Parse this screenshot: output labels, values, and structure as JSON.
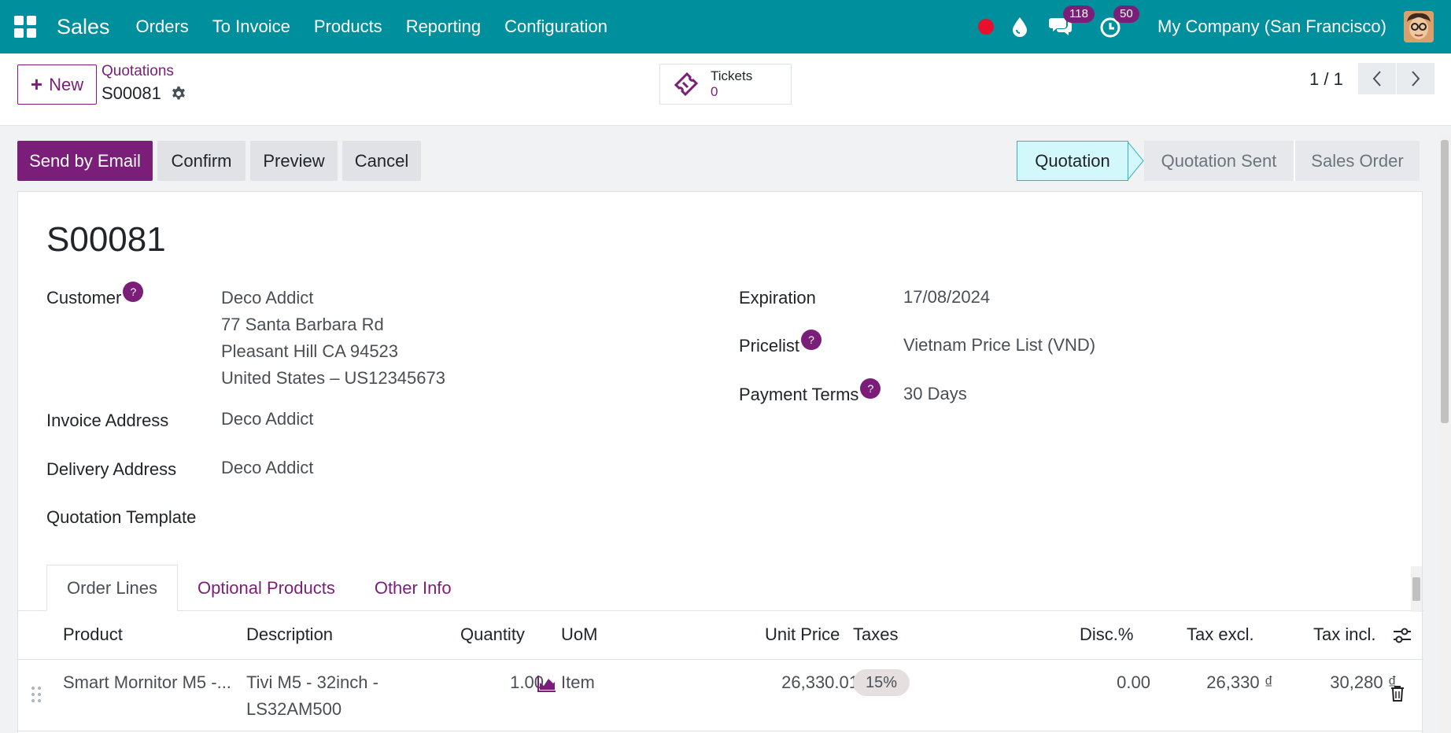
{
  "navbar": {
    "app_name": "Sales",
    "menu": [
      "Orders",
      "To Invoice",
      "Products",
      "Reporting",
      "Configuration"
    ],
    "messages_count": "118",
    "activities_count": "50",
    "company": "My Company (San Francisco)",
    "accent": "#008f9c"
  },
  "control": {
    "new_label": "New",
    "breadcrumb_parent": "Quotations",
    "breadcrumb_current": "S00081",
    "tickets_label": "Tickets",
    "tickets_count": "0",
    "pager": "1 / 1"
  },
  "actions": {
    "send_email": "Send by Email",
    "confirm": "Confirm",
    "preview": "Preview",
    "cancel": "Cancel"
  },
  "status": {
    "stages": [
      "Quotation",
      "Quotation Sent",
      "Sales Order"
    ],
    "active": "Quotation"
  },
  "form": {
    "title": "S00081",
    "customer_label": "Customer",
    "customer_lines": [
      "Deco Addict",
      "77 Santa Barbara Rd",
      "Pleasant Hill CA 94523",
      "United States – US12345673"
    ],
    "invoice_label": "Invoice Address",
    "invoice_value": "Deco Addict",
    "delivery_label": "Delivery Address",
    "delivery_value": "Deco Addict",
    "template_label": "Quotation Template",
    "expiration_label": "Expiration",
    "expiration_value": "17/08/2024",
    "pricelist_label": "Pricelist",
    "pricelist_value": "Vietnam Price List (VND)",
    "payment_label": "Payment Terms",
    "payment_value": "30 Days",
    "help_mark": "?"
  },
  "tabs": [
    "Order Lines",
    "Optional Products",
    "Other Info"
  ],
  "table": {
    "headers": {
      "product": "Product",
      "description": "Description",
      "quantity": "Quantity",
      "uom": "UoM",
      "unit_price": "Unit Price",
      "taxes": "Taxes",
      "disc": "Disc.%",
      "tax_excl": "Tax excl.",
      "tax_incl": "Tax incl."
    },
    "rows": [
      {
        "product": "Smart Mornitor M5 -...",
        "description_1": "Tivi M5 - 32inch -",
        "description_2": "LS32AM500",
        "quantity": "1.00",
        "uom": "Item",
        "unit_price": "26,330.01",
        "tax": "15%",
        "disc": "0.00",
        "tax_excl": "26,330 ₫",
        "tax_incl": "30,280 ₫"
      }
    ]
  },
  "colors": {
    "brand": "#7b1e7a",
    "navbar": "#008f9c",
    "active_stage": "#d2f8fb"
  }
}
